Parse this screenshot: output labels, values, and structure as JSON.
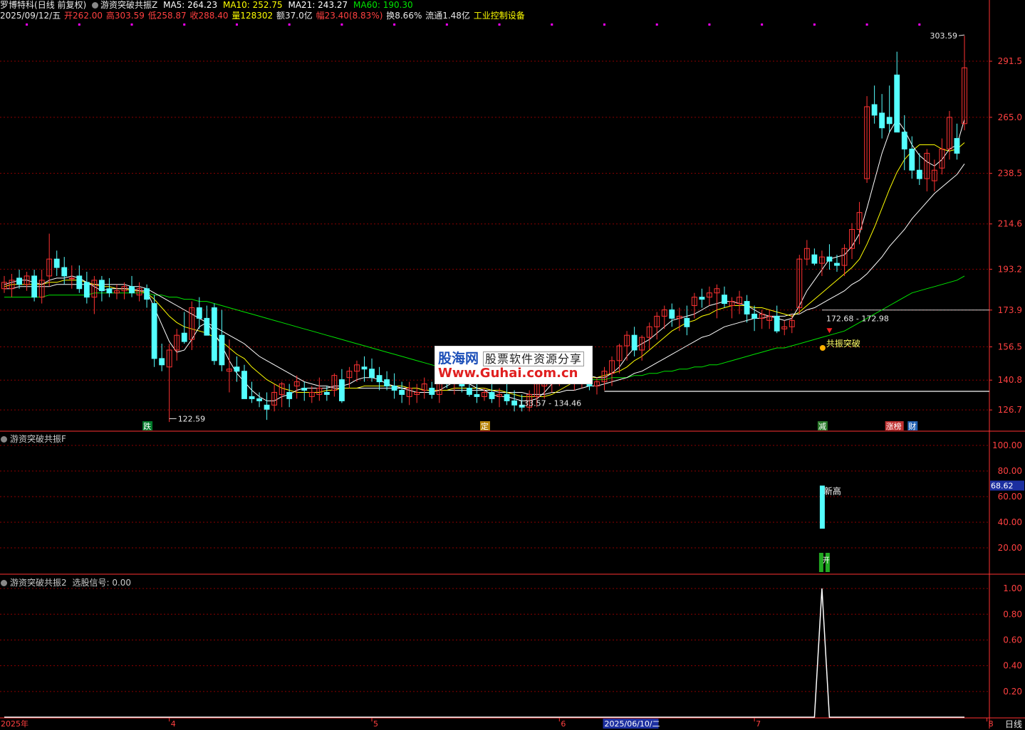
{
  "header": {
    "stock_name": "罗博特科",
    "period_mode": "(日线 前复权)",
    "indicator_name": "游资突破共振Z",
    "ma5_label": "MA5: 264.23",
    "ma10_label": "MA10: 252.75",
    "ma21_label": "MA21: 243.27",
    "ma60_label": "MA60: 190.30",
    "date": "2025/09/12/五",
    "open": "开262.00",
    "high": "高303.59",
    "low": "低258.87",
    "close": "收288.40",
    "volume": "量128302",
    "amount": "额37.0亿",
    "change": "幅23.40(8.83%)",
    "turnover": "换8.66%",
    "float": "流通1.48亿",
    "industry": "工业控制设备"
  },
  "panes": {
    "pane2_title": "游资突破共振F",
    "pane3_title": "游资突破共振2",
    "pane3_signal": "选股信号: 0.00"
  },
  "footer": {
    "period_button": "日线"
  },
  "watermark": {
    "line1": "股海网",
    "line1_sub": "股票软件资源分享",
    "line2": "Www.Guhai.com.cn"
  },
  "colors": {
    "up": "#ff3232",
    "down": "#54ffff",
    "ma5": "#ffffff",
    "ma10": "#ffff00",
    "ma21": "#ffffff",
    "ma60": "#00e600",
    "grid": "#8b0000",
    "axis": "#ff3232"
  },
  "chart_data": [
    {
      "type": "candlestick",
      "title": "罗博特科 (日线 前复权)",
      "y_ticks": [
        "291.5",
        "265.0",
        "238.5",
        "214.6",
        "193.2",
        "173.9",
        "156.5",
        "140.8",
        "126.7"
      ],
      "ylim": [
        117,
        309
      ],
      "x_ticks": [
        "2025年",
        "4",
        "5",
        "6",
        "2025/06/10/二",
        "7",
        "8",
        "9"
      ],
      "candles": [
        [
          184,
          190,
          182,
          187
        ],
        [
          184,
          191,
          180,
          188
        ],
        [
          189,
          193,
          184,
          186
        ],
        [
          186,
          192,
          183,
          190
        ],
        [
          190,
          193,
          178,
          180
        ],
        [
          180,
          193,
          177,
          188
        ],
        [
          190,
          210,
          185,
          198
        ],
        [
          198,
          202,
          190,
          194
        ],
        [
          194,
          199,
          186,
          190
        ],
        [
          189,
          195,
          184,
          189
        ],
        [
          190,
          195,
          182,
          184
        ],
        [
          187,
          192,
          177,
          180
        ],
        [
          180,
          190,
          172,
          188
        ],
        [
          188,
          190,
          178,
          183
        ],
        [
          184,
          189,
          180,
          182
        ],
        [
          182,
          186,
          179,
          183
        ],
        [
          183,
          187,
          179,
          185
        ],
        [
          185,
          190,
          180,
          182
        ],
        [
          181,
          187,
          178,
          184
        ],
        [
          184,
          186,
          175,
          179
        ],
        [
          177,
          181,
          147,
          151
        ],
        [
          151,
          158,
          145,
          148
        ],
        [
          147,
          158,
          121,
          155
        ],
        [
          155,
          165,
          150,
          162
        ],
        [
          163,
          173,
          158,
          159
        ],
        [
          160,
          178,
          155,
          175
        ],
        [
          175,
          180,
          165,
          170
        ],
        [
          170,
          176,
          165,
          162
        ],
        [
          175,
          177,
          148,
          150
        ],
        [
          162,
          174,
          145,
          148
        ],
        [
          145,
          160,
          135,
          146
        ],
        [
          147,
          152,
          140,
          145
        ],
        [
          145,
          148,
          134,
          132
        ],
        [
          133,
          140,
          130,
          132
        ],
        [
          132,
          135,
          128,
          131
        ],
        [
          129,
          135,
          122,
          127
        ],
        [
          129,
          139,
          126,
          135
        ],
        [
          134,
          140,
          128,
          139
        ],
        [
          135,
          139,
          128,
          132
        ],
        [
          138,
          143,
          132,
          140
        ],
        [
          137,
          140,
          131,
          136
        ],
        [
          133,
          138,
          130,
          135
        ],
        [
          134,
          142,
          131,
          137
        ],
        [
          135,
          138,
          131,
          134
        ],
        [
          136,
          144,
          133,
          143
        ],
        [
          141,
          146,
          130,
          131
        ],
        [
          142,
          147,
          137,
          145
        ],
        [
          145,
          150,
          140,
          148
        ],
        [
          147,
          152,
          140,
          146
        ],
        [
          146,
          151,
          140,
          142
        ],
        [
          143,
          147,
          136,
          140
        ],
        [
          141,
          145,
          136,
          138
        ],
        [
          138,
          144,
          132,
          136
        ],
        [
          136,
          140,
          130,
          134
        ],
        [
          133,
          140,
          129,
          137
        ],
        [
          134,
          139,
          130,
          135
        ],
        [
          136,
          142,
          132,
          139
        ],
        [
          137,
          140,
          132,
          134
        ],
        [
          134,
          145,
          130,
          144
        ],
        [
          144,
          151,
          137,
          140
        ],
        [
          140,
          147,
          134,
          143
        ],
        [
          142,
          148,
          135,
          138
        ],
        [
          137,
          148,
          133,
          134
        ],
        [
          134,
          145,
          130,
          133
        ],
        [
          133,
          137,
          131,
          135
        ],
        [
          135,
          140,
          130,
          132
        ],
        [
          133,
          137,
          128,
          134
        ],
        [
          134,
          139,
          129,
          131
        ],
        [
          131,
          136,
          126,
          129
        ],
        [
          129,
          134,
          126,
          128
        ],
        [
          128,
          136,
          126,
          134
        ],
        [
          133,
          140,
          128,
          139
        ],
        [
          138,
          142,
          132,
          139
        ],
        [
          139,
          146,
          135,
          143
        ],
        [
          143,
          149,
          138,
          147
        ],
        [
          147,
          150,
          140,
          143
        ],
        [
          143,
          148,
          136,
          144
        ],
        [
          144,
          149,
          137,
          147
        ],
        [
          143,
          147,
          136,
          138
        ],
        [
          138,
          142,
          134,
          140
        ],
        [
          140,
          147,
          136,
          145
        ],
        [
          144,
          152,
          138,
          150
        ],
        [
          150,
          158,
          144,
          157
        ],
        [
          157,
          164,
          150,
          162
        ],
        [
          162,
          166,
          152,
          155
        ],
        [
          155,
          162,
          150,
          161
        ],
        [
          161,
          168,
          155,
          166
        ],
        [
          166,
          173,
          160,
          171
        ],
        [
          171,
          176,
          165,
          174
        ],
        [
          174,
          177,
          166,
          170
        ],
        [
          170,
          175,
          164,
          171
        ],
        [
          170,
          176,
          162,
          166
        ],
        [
          176,
          182,
          170,
          180
        ],
        [
          180,
          184,
          175,
          179
        ],
        [
          180,
          185,
          176,
          182
        ],
        [
          182,
          186,
          170,
          184
        ],
        [
          181,
          185,
          175,
          177
        ],
        [
          176,
          180,
          170,
          178
        ],
        [
          177,
          183,
          172,
          180
        ],
        [
          178,
          181,
          168,
          172
        ],
        [
          172,
          176,
          164,
          170
        ],
        [
          170,
          174,
          165,
          172
        ],
        [
          169,
          174,
          165,
          171
        ],
        [
          171,
          176,
          163,
          164
        ],
        [
          165,
          169,
          162,
          166
        ],
        [
          166,
          172,
          163,
          169
        ],
        [
          175,
          200,
          172,
          198
        ],
        [
          198,
          207,
          195,
          203
        ],
        [
          200,
          203,
          195,
          196
        ],
        [
          196,
          202,
          190,
          199
        ],
        [
          199,
          205,
          193,
          197
        ],
        [
          196,
          200,
          192,
          195
        ],
        [
          195,
          205,
          190,
          203
        ],
        [
          203,
          215,
          198,
          212
        ],
        [
          212,
          225,
          205,
          220
        ],
        [
          236,
          275,
          234,
          270
        ],
        [
          271,
          280,
          262,
          266
        ],
        [
          267,
          276,
          255,
          260
        ],
        [
          265,
          280,
          258,
          262
        ],
        [
          285,
          296,
          260,
          258
        ],
        [
          258,
          266,
          240,
          250
        ],
        [
          250,
          256,
          236,
          240
        ],
        [
          240,
          248,
          233,
          236
        ],
        [
          236,
          250,
          230,
          248
        ],
        [
          235,
          245,
          230,
          240
        ],
        [
          241,
          255,
          238,
          250
        ],
        [
          250,
          268,
          245,
          265
        ],
        [
          255,
          262,
          245,
          248
        ],
        [
          262,
          303.59,
          258.87,
          288.4
        ]
      ],
      "ma5": [
        186,
        187,
        188,
        188,
        187,
        186,
        188,
        189,
        189,
        190,
        189,
        187,
        185,
        183,
        184,
        184,
        184,
        184,
        183,
        183,
        175,
        167,
        159,
        154,
        155,
        160,
        166,
        168,
        163,
        157,
        150,
        144,
        140,
        136,
        133,
        131,
        131,
        133,
        134,
        136,
        137,
        137,
        137,
        137,
        138,
        138,
        139,
        141,
        142,
        142,
        141,
        139,
        138,
        137,
        136,
        135,
        135,
        135,
        136,
        138,
        140,
        141,
        139,
        137,
        136,
        134,
        133,
        133,
        132,
        131,
        131,
        132,
        135,
        139,
        142,
        144,
        145,
        145,
        143,
        142,
        142,
        144,
        147,
        152,
        156,
        158,
        160,
        163,
        166,
        169,
        170,
        171,
        172,
        174,
        176,
        177,
        178,
        178,
        177,
        176,
        174,
        172,
        171,
        170,
        169,
        170,
        176,
        183,
        188,
        193,
        198,
        199,
        200,
        204,
        210,
        222,
        235,
        248,
        258,
        264,
        259,
        252,
        247,
        244,
        242,
        245,
        250,
        252,
        264
      ],
      "ma10": [
        185,
        186,
        186,
        186,
        186,
        186,
        187,
        187,
        188,
        188,
        188,
        187,
        186,
        185,
        185,
        184,
        184,
        183,
        183,
        182,
        179,
        175,
        171,
        168,
        166,
        165,
        164,
        163,
        161,
        159,
        156,
        153,
        151,
        147,
        144,
        141,
        139,
        137,
        136,
        135,
        135,
        135,
        135,
        136,
        136,
        137,
        137,
        137,
        138,
        138,
        138,
        138,
        138,
        138,
        137,
        137,
        136,
        136,
        136,
        136,
        137,
        137,
        137,
        137,
        137,
        136,
        136,
        135,
        134,
        133,
        133,
        133,
        133,
        134,
        136,
        138,
        140,
        141,
        142,
        142,
        143,
        144,
        145,
        147,
        150,
        152,
        155,
        158,
        161,
        164,
        166,
        168,
        169,
        171,
        172,
        174,
        175,
        176,
        176,
        176,
        175,
        175,
        174,
        173,
        172,
        171,
        173,
        176,
        179,
        182,
        185,
        188,
        191,
        194,
        198,
        205,
        213,
        222,
        231,
        239,
        245,
        249,
        252,
        252,
        252,
        250,
        249,
        250,
        253
      ],
      "ma21": [
        184,
        184,
        185,
        185,
        185,
        185,
        185,
        186,
        186,
        186,
        186,
        186,
        186,
        186,
        186,
        186,
        186,
        185,
        185,
        184,
        182,
        180,
        178,
        176,
        174,
        172,
        170,
        168,
        166,
        164,
        162,
        160,
        158,
        155,
        152,
        150,
        148,
        146,
        144,
        142,
        140,
        139,
        138,
        138,
        137,
        137,
        137,
        137,
        137,
        137,
        137,
        137,
        137,
        137,
        137,
        137,
        136,
        136,
        136,
        136,
        136,
        136,
        136,
        136,
        136,
        136,
        135,
        135,
        135,
        135,
        134,
        134,
        134,
        135,
        135,
        136,
        136,
        137,
        138,
        138,
        139,
        140,
        141,
        142,
        144,
        145,
        147,
        149,
        151,
        153,
        155,
        157,
        159,
        161,
        162,
        164,
        166,
        167,
        168,
        169,
        170,
        170,
        171,
        171,
        171,
        172,
        172,
        174,
        175,
        177,
        179,
        181,
        183,
        186,
        188,
        191,
        195,
        199,
        204,
        208,
        212,
        217,
        221,
        225,
        229,
        232,
        235,
        238,
        243
      ],
      "ma60": [
        180,
        180,
        180,
        180,
        180,
        180,
        181,
        181,
        181,
        181,
        181,
        181,
        182,
        182,
        182,
        182,
        182,
        182,
        182,
        182,
        181,
        181,
        180,
        180,
        179,
        179,
        178,
        178,
        177,
        176,
        175,
        174,
        173,
        172,
        171,
        170,
        169,
        168,
        167,
        166,
        165,
        164,
        163,
        162,
        161,
        160,
        159,
        158,
        157,
        156,
        155,
        154,
        153,
        152,
        151,
        150,
        149,
        148,
        147,
        146,
        145,
        144,
        143,
        142,
        141,
        141,
        140,
        140,
        140,
        140,
        140,
        140,
        140,
        140,
        140,
        140,
        140,
        141,
        141,
        141,
        141,
        142,
        142,
        142,
        143,
        143,
        144,
        144,
        145,
        145,
        146,
        146,
        147,
        147,
        148,
        148,
        149,
        150,
        151,
        152,
        153,
        154,
        155,
        156,
        156,
        157,
        158,
        159,
        160,
        161,
        162,
        163,
        164,
        166,
        168,
        170,
        172,
        174,
        176,
        178,
        180,
        182,
        183,
        184,
        185,
        186,
        187,
        188,
        190
      ],
      "annotations": {
        "max": "303.59",
        "min": "122.59",
        "range1": "133.57 - 134.46",
        "range2": "172.68 - 172.98",
        "signal": "共振突破"
      },
      "event_tags": [
        "跌",
        "定",
        "减",
        "涨榜",
        "财"
      ],
      "hline_levels": [
        173.9,
        135.5
      ]
    },
    {
      "type": "bar",
      "title": "游资突破共振F",
      "y_ticks": [
        "100.00",
        "80.00",
        "60.00",
        "40.00",
        "20.00"
      ],
      "ylim": [
        0,
        110
      ],
      "current_value": "68.62",
      "bar_top": 68.62,
      "bar_bottom": 35,
      "bar_label": "新高",
      "small_bar_label": "开"
    },
    {
      "type": "line",
      "title": "游资突破共振2",
      "y_ticks": [
        "1.00",
        "0.80",
        "0.60",
        "0.40",
        "0.20"
      ],
      "ylim": [
        0,
        1.1
      ],
      "peak_index": 109,
      "peak_value": 1.0
    }
  ]
}
